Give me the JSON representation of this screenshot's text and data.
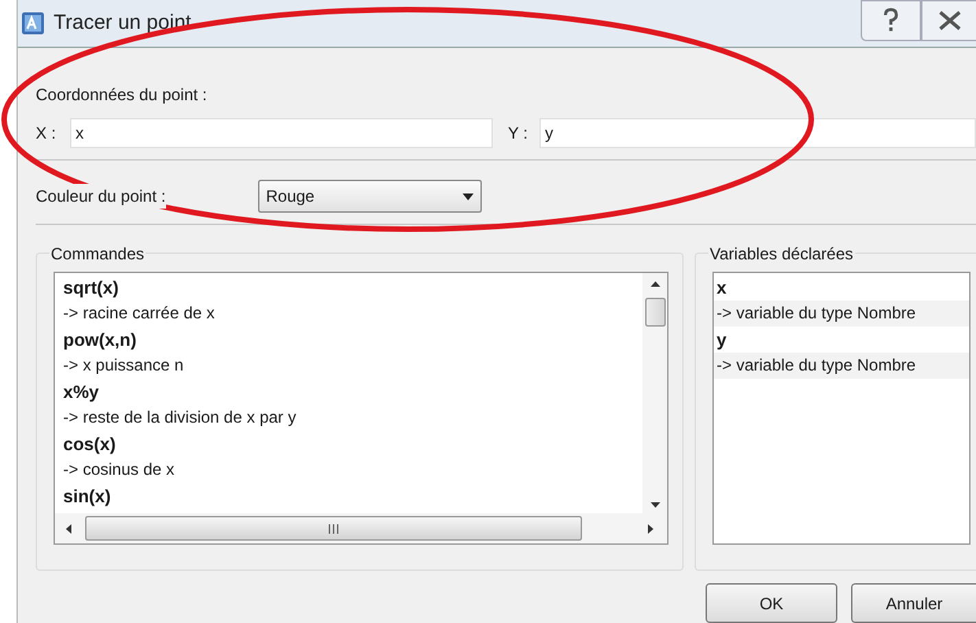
{
  "window": {
    "title": "Tracer un point"
  },
  "coordinates": {
    "label": "Coordonnées du point :",
    "x_label": "X :",
    "x_value": "x",
    "y_label": "Y :",
    "y_value": "y"
  },
  "color_field": {
    "label": "Couleur du point :",
    "value": "Rouge"
  },
  "commands": {
    "title": "Commandes",
    "items": [
      {
        "kind": "function",
        "text": "sqrt(x)"
      },
      {
        "kind": "description",
        "text": "-> racine carrée de x"
      },
      {
        "kind": "function",
        "text": "pow(x,n)"
      },
      {
        "kind": "description",
        "text": "-> x puissance n"
      },
      {
        "kind": "function",
        "text": "x%y"
      },
      {
        "kind": "description",
        "text": "-> reste de la division de x par y"
      },
      {
        "kind": "function",
        "text": "cos(x)"
      },
      {
        "kind": "description",
        "text": "-> cosinus de x"
      },
      {
        "kind": "function",
        "text": "sin(x)"
      }
    ]
  },
  "variables": {
    "title": "Variables déclarées",
    "items": [
      {
        "kind": "function",
        "text": "x"
      },
      {
        "kind": "description",
        "text": "-> variable du type Nombre"
      },
      {
        "kind": "function",
        "text": "y"
      },
      {
        "kind": "description",
        "text": "-> variable du type Nombre"
      }
    ]
  },
  "buttons": [
    "OK",
    "Annuler"
  ]
}
